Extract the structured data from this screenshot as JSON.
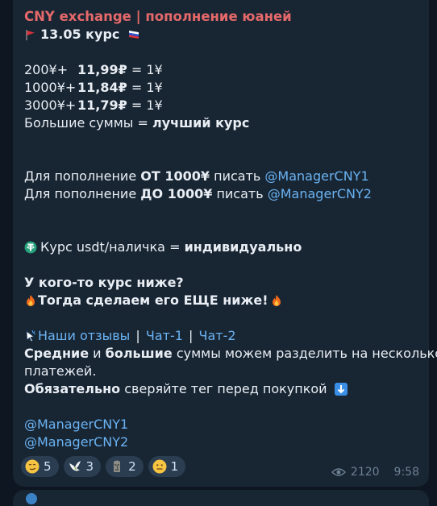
{
  "channel_title": "CNY exchange | пополнение юаней",
  "date_line": "13.05 курс",
  "rates": [
    {
      "prefix": "200¥+",
      "rate": "11,99₽",
      "suffix": " = 1¥"
    },
    {
      "prefix": "1000¥+",
      "rate": "11,84₽",
      "suffix": " = 1¥"
    },
    {
      "prefix": "3000¥+",
      "rate": "11,79₽",
      "suffix": " = 1¥"
    }
  ],
  "big_sums": {
    "text": "Большие суммы = ",
    "bold": "лучший курс"
  },
  "contact_from": {
    "t1": "Для пополнение ",
    "b1": "ОТ 1000¥",
    "t2": " писать ",
    "link": "@ManagerCNY1"
  },
  "contact_to": {
    "t1": "Для пополнение ",
    "b1": "ДО 1000¥",
    "t2": " писать ",
    "link": "@ManagerCNY2"
  },
  "usdt": {
    "text": "Курс usdt/наличка = ",
    "bold": "индивидуально"
  },
  "lower_rate_q": "У кого-то курс ниже?",
  "lower_rate_a": "Тогда сделаем его ЕЩЕ ниже!",
  "links_row": {
    "reviews": "Наши отзывы",
    "sep": "|",
    "chat1": "Чат-1",
    "chat2": "Чат-2"
  },
  "split": {
    "b1": "Средние",
    "t1": " и ",
    "b2": "большие",
    "t2": " суммы можем разделить на несколько"
  },
  "split_line2": "платежей.",
  "tag_check": {
    "bold": "Обязательно",
    "text": " сверяйте тег перед покупкой"
  },
  "footer_links": [
    "@ManagerCNY1",
    "@ManagerCNY2"
  ],
  "reactions": [
    {
      "icon": "smirk-emoji-icon",
      "count": "5"
    },
    {
      "icon": "dove-emoji-icon",
      "count": "3"
    },
    {
      "icon": "moai-emoji-icon",
      "count": "2"
    },
    {
      "icon": "neutral-face-emoji-icon",
      "count": "1"
    }
  ],
  "views": "2120",
  "time": "9:58",
  "colors": {
    "title": "#e5696a",
    "link": "#6ab3f3",
    "bubble": "#182533",
    "background": "#0e1621"
  }
}
